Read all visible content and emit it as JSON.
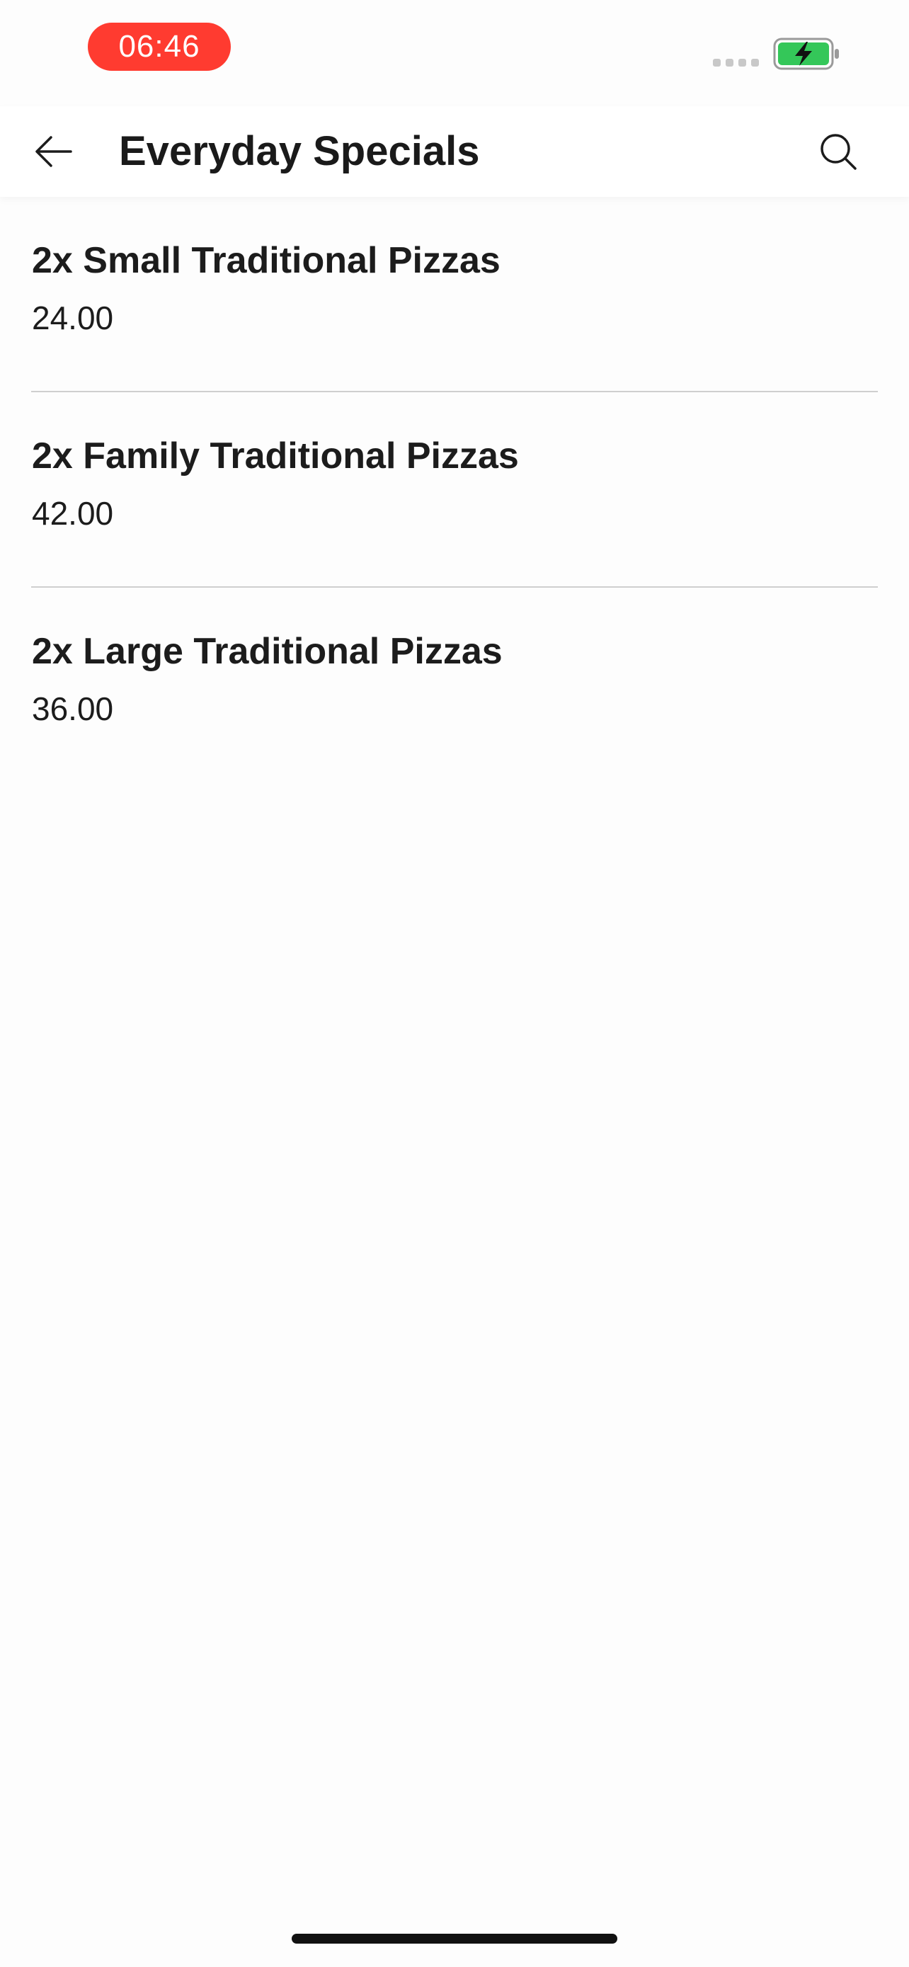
{
  "status_bar": {
    "time": "06:46",
    "time_pill_color": "#ff3b30",
    "signal_icon": "cellular-signal-icon",
    "battery_icon": "battery-charging-icon",
    "battery_color": "#34c759"
  },
  "header": {
    "title": "Everyday Specials",
    "back_icon": "arrow-left-icon",
    "search_icon": "search-icon"
  },
  "items": [
    {
      "name": "2x Small Traditional Pizzas",
      "price": "24.00"
    },
    {
      "name": "2x Family Traditional Pizzas",
      "price": "42.00"
    },
    {
      "name": "2x Large Traditional Pizzas",
      "price": "36.00"
    }
  ]
}
